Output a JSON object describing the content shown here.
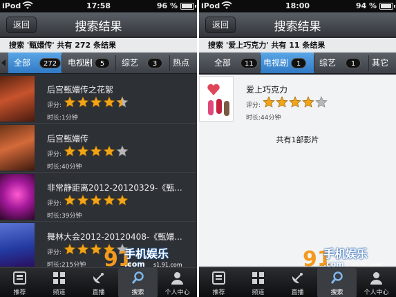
{
  "colors": {
    "accent_tab": "#2f78c4",
    "star": "#f1a418",
    "star_empty": "#b8b8b8",
    "watermark": "#f39a1e"
  },
  "left": {
    "status": {
      "carrier": "iPod",
      "time": "17:58",
      "battery": "96 %",
      "battery_level": 0.96
    },
    "nav": {
      "back": "返回",
      "title": "搜索结果"
    },
    "summary": "搜索 '甄嬛传' 共有 272 条结果",
    "tabs": [
      {
        "label": "全部",
        "count": "272",
        "active": true
      },
      {
        "label": "电视剧",
        "count": "5",
        "active": false
      },
      {
        "label": "综艺",
        "count": "3",
        "active": false
      },
      {
        "label": "热点",
        "count": "",
        "active": false
      }
    ],
    "items": [
      {
        "title": "后宫甄嬛传之花絮",
        "rating_label": "评分:",
        "stars": 4.5,
        "duration": "时长:1分钟",
        "thumb_icon": "palace-drama-poster"
      },
      {
        "title": "后宫甄嬛传",
        "rating_label": "评分:",
        "stars": 4,
        "duration": "时长:40分钟",
        "thumb_icon": "palace-drama-poster"
      },
      {
        "title": "非常静距离2012-20120329-《甄...",
        "rating_label": "评分:",
        "stars": 5,
        "duration": "时长:39分钟",
        "thumb_icon": "variety-show-stage"
      },
      {
        "title": "舞林大会2012-20120408-《甄嬛...",
        "rating_label": "评分:",
        "stars": 4,
        "duration": "时长:215分钟",
        "thumb_icon": "dance-show-stage"
      }
    ]
  },
  "right": {
    "status": {
      "carrier": "iPod",
      "time": "18:00",
      "battery": "94 %",
      "battery_level": 0.94
    },
    "nav": {
      "back": "返回",
      "title": "搜索结果"
    },
    "summary": "搜索 '爱上巧克力' 共有 11 条结果",
    "tabs": [
      {
        "label": "全部",
        "count": "11",
        "active": false
      },
      {
        "label": "电视剧",
        "count": "1",
        "active": true
      },
      {
        "label": "综艺",
        "count": "1",
        "active": false
      },
      {
        "label": "其它",
        "count": "",
        "active": false
      }
    ],
    "items": [
      {
        "title": "爱上巧克力",
        "rating_label": "评分:",
        "stars": 4,
        "duration": "时长:44分钟",
        "thumb_icon": "romance-drama-poster"
      }
    ],
    "footer_note": "共有1部影片"
  },
  "tabbar": [
    {
      "label": "推荐",
      "icon": "recommend-icon"
    },
    {
      "label": "频道",
      "icon": "channel-grid-icon"
    },
    {
      "label": "直播",
      "icon": "satellite-dish-icon"
    },
    {
      "label": "搜索",
      "icon": "search-icon",
      "active": true
    },
    {
      "label": "个人中心",
      "icon": "user-icon"
    }
  ],
  "watermark": {
    "logo": "91",
    "brand": "手机娱乐",
    "domain": ".com",
    "domain_small": "s1.91.com"
  }
}
